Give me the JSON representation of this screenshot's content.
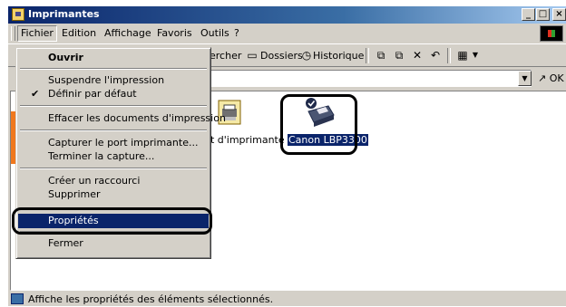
{
  "window": {
    "title": "Imprimantes",
    "minimize_glyph": "_",
    "maximize_glyph": "□",
    "close_glyph": "×"
  },
  "menubar": {
    "items": [
      "Fichier",
      "Edition",
      "Affichage",
      "Favoris",
      "Outils",
      "?"
    ]
  },
  "toolbar": {
    "search_partial": "ercher",
    "folders": "Dossiers",
    "history": "Historique"
  },
  "addressbar": {
    "go_label": "OK"
  },
  "content": {
    "items": [
      {
        "label": "ut d'imprimante",
        "icon": "add-printer-icon",
        "selected": false
      },
      {
        "label": "Canon LBP3300",
        "icon": "printer-icon",
        "selected": true
      }
    ]
  },
  "file_menu": {
    "items": [
      {
        "label": "Ouvrir",
        "bold": true
      },
      {
        "label": "Suspendre l'impression"
      },
      {
        "label": "Définir par défaut",
        "checked": true
      },
      {
        "label": "Effacer les documents d'impression"
      },
      {
        "label": "Capturer le port imprimante..."
      },
      {
        "label": "Terminer la capture..."
      },
      {
        "label": "Créer un raccourci"
      },
      {
        "label": "Supprimer"
      },
      {
        "label": "Propriétés",
        "selected": true
      },
      {
        "label": "Fermer"
      }
    ]
  },
  "statusbar": {
    "text": "Affiche les propriétés des éléments sélectionnés."
  },
  "colors": {
    "selection": "#0a246a",
    "face": "#d4d0c8",
    "highlight_ring": "#000000"
  }
}
